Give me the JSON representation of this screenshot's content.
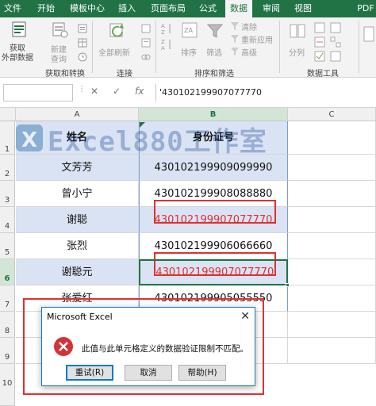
{
  "ribbon": {
    "tabs": [
      "文件",
      "开始",
      "模板中心",
      "插入",
      "页面布局",
      "公式",
      "数据",
      "审阅",
      "视图",
      "PDF"
    ],
    "active_tab": "数据",
    "get_data_label_1": "获取",
    "get_data_label_2": "外部数据",
    "new_query_label_1": "新建",
    "new_query_label_2": "查询",
    "refresh_all_label_1": "全部刷新",
    "group_get_transform": "获取和转换",
    "group_connections": "连接",
    "sort_label": "排序",
    "filter_label": "筛选",
    "clear_label": "清除",
    "reapply_label": "重新应用",
    "advanced_label": "高级",
    "group_sort_filter": "排序和筛选",
    "split_label": "分列",
    "group_data_tools": "数据工具"
  },
  "formula_bar": {
    "name_box": "",
    "cancel_glyph": "✕",
    "enter_glyph": "✓",
    "fx_glyph": "fx",
    "value": "'430102199907077770"
  },
  "sheet": {
    "columns": [
      "A",
      "B",
      "C"
    ],
    "rows": [
      "1",
      "2",
      "3",
      "4",
      "5",
      "6",
      "7",
      "8",
      "9",
      "10"
    ],
    "header": {
      "a": "姓名",
      "b": "身份证号"
    },
    "data": [
      {
        "name": "文芳芳",
        "id": "430102199909099990"
      },
      {
        "name": "曾小宁",
        "id": "430102199908088880"
      },
      {
        "name": "谢聪",
        "id": "430102199907077770"
      },
      {
        "name": "张烈",
        "id": "430102199906066660"
      },
      {
        "name": "谢聪元",
        "id": "'430102199907077770"
      },
      {
        "name": "张爱红",
        "id": "430102199905055550"
      }
    ]
  },
  "watermark": {
    "text": "Excel880工作室",
    "logo": "X"
  },
  "dialog": {
    "title": "Microsoft Excel",
    "message": "此值与此单元格定义的数据验证限制不匹配。",
    "retry": "重试(R)",
    "cancel": "取消",
    "help": "帮助(H)",
    "close_glyph": "✕"
  },
  "colors": {
    "excel_green": "#217346",
    "blue_fill": "#dae3f3",
    "error_red": "#e03030",
    "dialog_border": "#1979ca"
  }
}
